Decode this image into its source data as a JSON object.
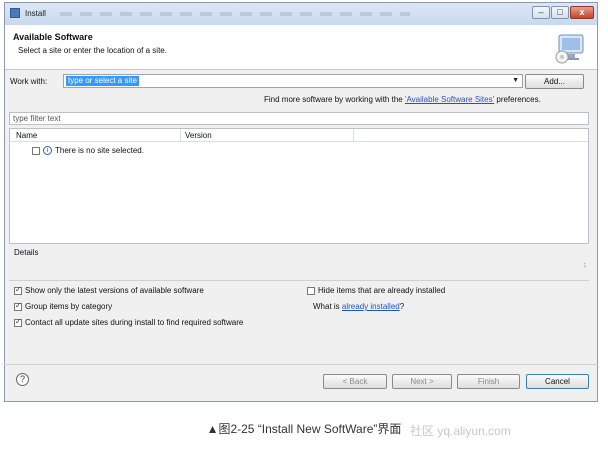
{
  "window": {
    "title": "Install",
    "controls": {
      "minimize": "–",
      "maximize": "□",
      "close": "x"
    }
  },
  "header": {
    "title": "Available Software",
    "subtitle": "Select a site or enter the location of a site.",
    "icon": "install-wizard-icon"
  },
  "work_with": {
    "label": "Work with:",
    "placeholder": "type or select a site",
    "add_button": "Add..."
  },
  "find_more": {
    "prefix": "Find more software by working with the ",
    "link": "'Available Software Sites'",
    "suffix": " preferences."
  },
  "filter": {
    "placeholder": "type filter text"
  },
  "table": {
    "columns": [
      "Name",
      "Version"
    ],
    "rows": [
      {
        "checked": false,
        "icon": "info-icon",
        "text": "There is no site selected."
      }
    ]
  },
  "details": {
    "label": "Details"
  },
  "options": {
    "show_latest": {
      "label": "Show only the latest versions of available software",
      "checked": true
    },
    "group_items": {
      "label": "Group items by category",
      "checked": true
    },
    "contact_sites": {
      "label": "Contact all update sites during install to find required software",
      "checked": true
    },
    "hide_installed": {
      "label": "Hide items that are already installed",
      "checked": false
    },
    "what_is": {
      "prefix": "What is ",
      "link": "already installed",
      "suffix": "?"
    }
  },
  "footer": {
    "help_icon": "help-icon",
    "back": "< Back",
    "next": "Next >",
    "finish": "Finish",
    "cancel": "Cancel"
  },
  "caption": "▲图2-25 “Install New SoftWare”界面",
  "watermark": "社区 yq.aliyun.com",
  "colors": {
    "selection": "#3399ff",
    "link": "#2255bb",
    "titlebar": "#c9d9ee",
    "close": "#c6432a"
  }
}
